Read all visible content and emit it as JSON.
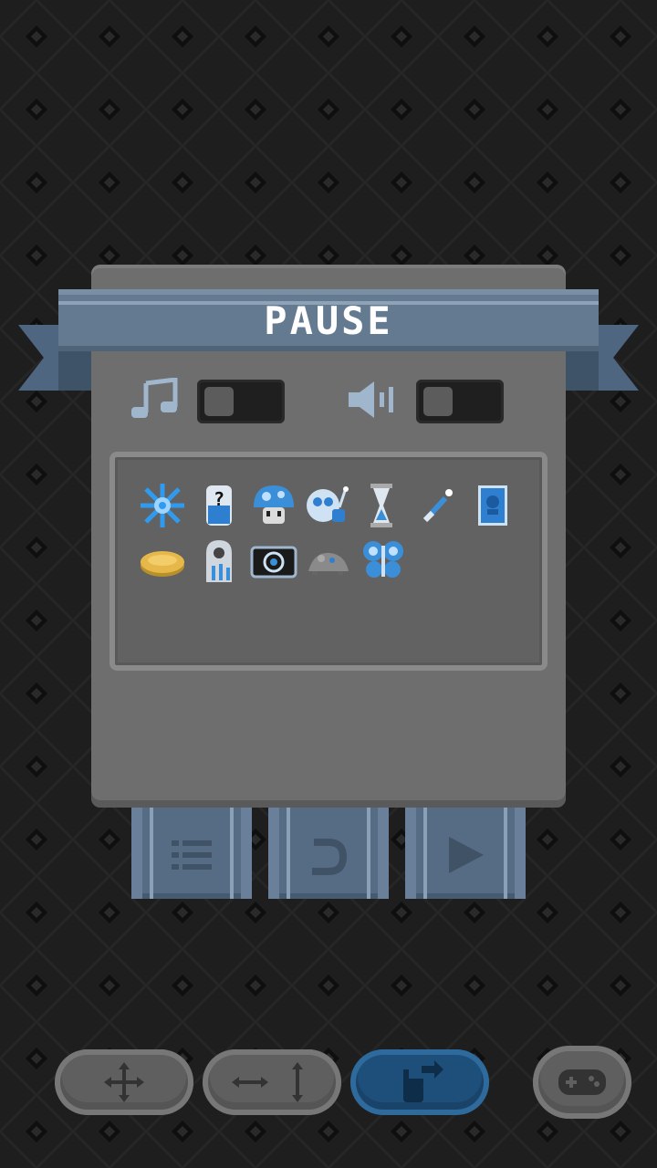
{
  "title": "PAUSE",
  "colors": {
    "background": "#1e1e1e",
    "panel": "#6e6e6e",
    "ribbon": "#647a90",
    "accent_blue": "#3b8fd8",
    "button_active": "#1d4f7a"
  },
  "settings": {
    "music": {
      "icon": "music-note-icon",
      "enabled": false
    },
    "sound": {
      "icon": "speaker-icon",
      "enabled": false
    }
  },
  "inventory": {
    "items": [
      {
        "name": "ice-crystal-icon"
      },
      {
        "name": "mystery-potion-icon"
      },
      {
        "name": "blue-mushroom-icon"
      },
      {
        "name": "ghost-bomb-icon"
      },
      {
        "name": "hourglass-icon"
      },
      {
        "name": "magic-wand-icon"
      },
      {
        "name": "blue-card-icon"
      },
      {
        "name": "gold-coin-icon"
      },
      {
        "name": "reaper-ghost-icon"
      },
      {
        "name": "eye-camera-icon"
      },
      {
        "name": "grey-mouse-icon"
      },
      {
        "name": "butterfly-icon"
      }
    ]
  },
  "buttons": {
    "menu": {
      "icon": "list-icon"
    },
    "restart": {
      "icon": "restart-icon"
    },
    "resume": {
      "icon": "play-icon"
    }
  },
  "control_modes": [
    {
      "icon": "dpad-icon",
      "active": false
    },
    {
      "icon": "arrows-split-icon",
      "active": false
    },
    {
      "icon": "touch-hand-icon",
      "active": true
    },
    {
      "icon": "gamepad-icon",
      "active": false
    }
  ]
}
